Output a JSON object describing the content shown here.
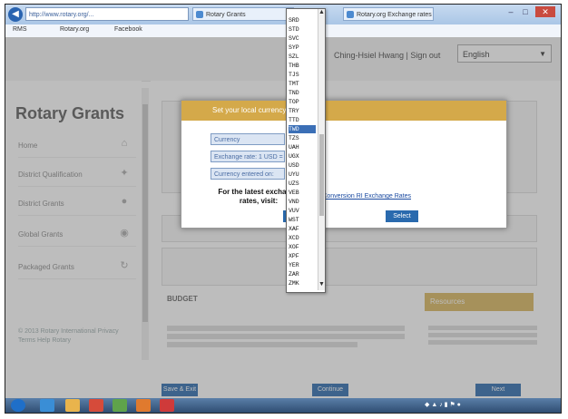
{
  "browser": {
    "address": "http://www.rotary.org/...",
    "tabs": [
      "Rotary Grants",
      "Rotary.org Exchange rates"
    ],
    "favorites": [
      "RMS",
      "Rotary.org",
      "Facebook"
    ]
  },
  "header": {
    "user_link": "Ching-Hsiel Hwang | Sign out",
    "language": "English"
  },
  "sidebar": {
    "title": "Rotary Grants",
    "items": [
      {
        "label": "Home",
        "icon": "home-icon"
      },
      {
        "label": "District Qualification",
        "icon": "pin-icon"
      },
      {
        "label": "District Grants",
        "icon": "circle-icon"
      },
      {
        "label": "Global Grants",
        "icon": "globe-icon"
      },
      {
        "label": "Packaged Grants",
        "icon": "refresh-icon"
      }
    ],
    "footer": "© 2013 Rotary International  Privacy  Terms  Help  Rotary"
  },
  "main": {
    "budget_title": "BUDGET",
    "resources_title": "Resources",
    "buttons": [
      "Save & Exit",
      "Continue",
      "Next"
    ]
  },
  "modal": {
    "title": "Set your local currency",
    "field_currency": "Currency",
    "field_rate": "Exchange rate: 1 USD =",
    "field_entered": "Currency entered on:",
    "info": "For the latest exchange rates, visit:",
    "links": "Currency Conversion  RI Exchange Rates",
    "select_label": "Select"
  },
  "currency_list": {
    "items": [
      "SRD",
      "STD",
      "SVC",
      "SYP",
      "SZL",
      "THB",
      "TJS",
      "TMT",
      "TND",
      "TOP",
      "TRY",
      "TTD",
      "TWD",
      "TZS",
      "UAH",
      "UGX",
      "USD",
      "UYU",
      "UZS",
      "VEB",
      "VND",
      "VUV",
      "WST",
      "XAF",
      "XCD",
      "XOF",
      "XPF",
      "YER",
      "ZAR",
      "ZMK"
    ],
    "selected": "TWD"
  },
  "colors": {
    "accent": "#d4a94a",
    "link": "#2a6aae"
  }
}
